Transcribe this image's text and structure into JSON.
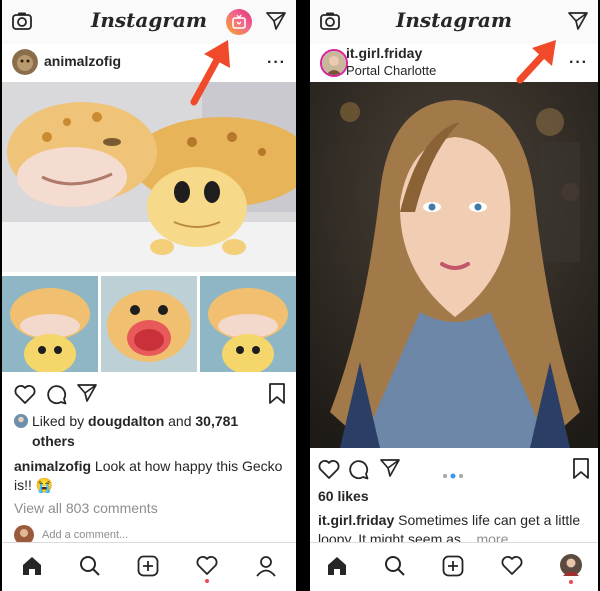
{
  "left": {
    "app_title": "Instagram",
    "post": {
      "username": "animalzofig",
      "more_label": "···",
      "liked_by_prefix": "Liked by",
      "liked_by_user": "dougdalton",
      "liked_by_and": "and",
      "likes_count": "30,781",
      "likes_suffix": "others",
      "caption_user": "animalzofig",
      "caption_text": "Look at how happy this Gecko is!!",
      "caption_emoji": "😭",
      "view_comments": "View all 803 comments",
      "add_comment_placeholder": "Add a comment..."
    },
    "bottom_nav": [
      "home-icon",
      "search-icon",
      "add-icon",
      "heart-icon",
      "profile-icon"
    ]
  },
  "right": {
    "app_title": "Instagram",
    "post": {
      "username": "it.girl.friday",
      "location": "Portal Charlotte",
      "more_label": "···",
      "likes": "60 likes",
      "caption_user": "it.girl.friday",
      "caption_text": "Sometimes life can get a little loopy. It might seem as...",
      "caption_more": "more",
      "carousel": {
        "count": 3,
        "active": 1
      }
    },
    "bottom_nav": [
      "home-icon",
      "search-icon",
      "add-icon",
      "heart-icon",
      "profile-icon"
    ]
  },
  "colors": {
    "annotation_arrow": "#f04a2a",
    "notification": "#ed4956",
    "link": "#8e8e8e",
    "dot_active": "#3897f0"
  }
}
